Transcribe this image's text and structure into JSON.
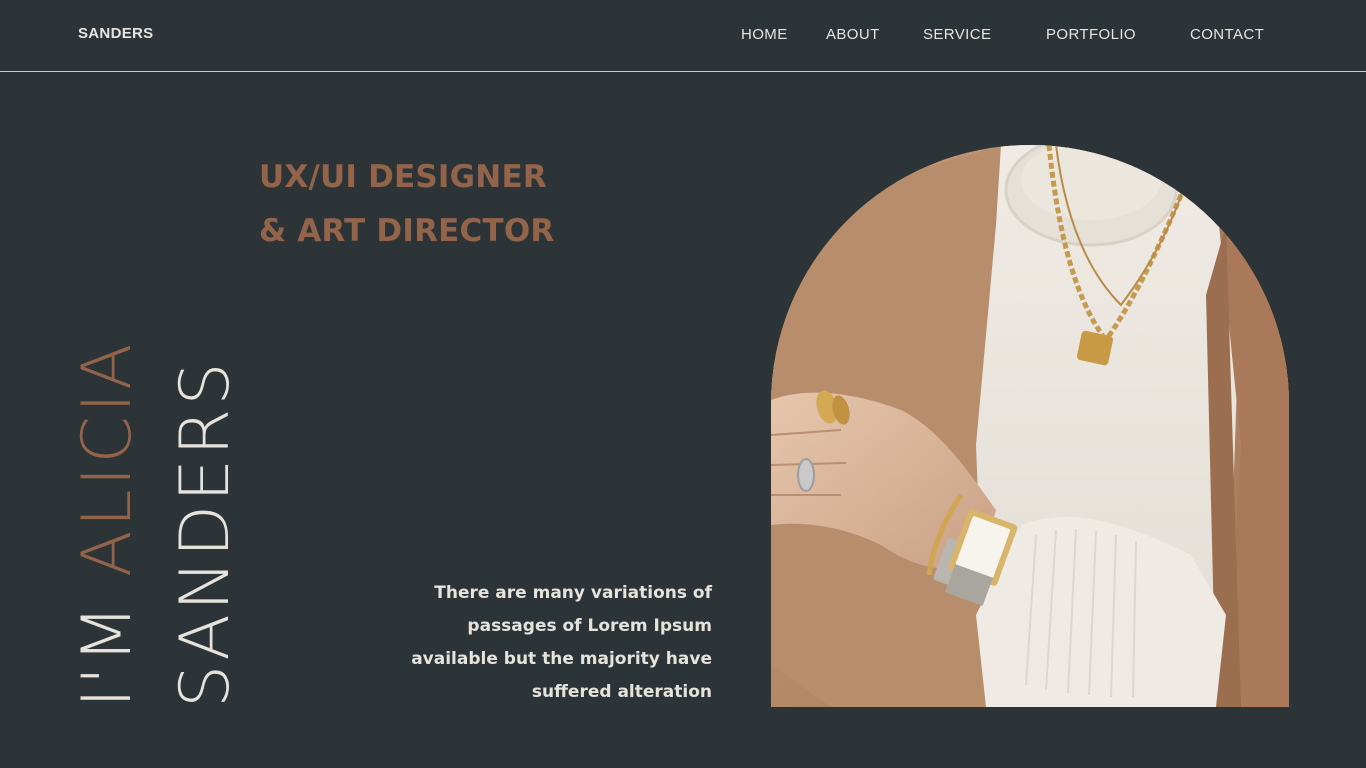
{
  "header": {
    "logo": "SANDERS",
    "nav": [
      "HOME",
      "ABOUT",
      "SERVICE",
      "PORTFOLIO",
      "CONTACT"
    ]
  },
  "hero": {
    "title_line1": "UX/UI DESIGNER",
    "title_line2": "& ART DIRECTOR",
    "name_line1_prefix": "I'M ",
    "name_line1_accent": "ALICIA",
    "name_line2": "SANDERS",
    "description": "There are many variations of passages of Lorem Ipsum available but the majority have suffered alteration"
  },
  "colors": {
    "background": "#2d3437",
    "accent": "#93644a",
    "text": "#e6e2dc"
  },
  "photo": {
    "subject": "model-photo"
  }
}
